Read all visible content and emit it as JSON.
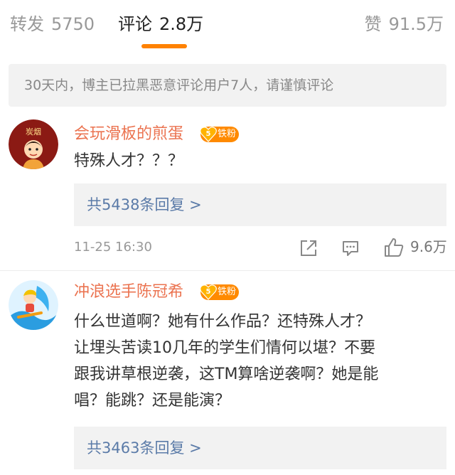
{
  "tabs": {
    "repost": {
      "label": "转发",
      "count": "5750"
    },
    "comments": {
      "label": "评论",
      "count": "2.8万"
    },
    "likes": {
      "label": "赞",
      "count": "91.5万"
    }
  },
  "notice": "30天内，博主已拉黑恶意评论用户7人，请谨慎评论",
  "comments": [
    {
      "username": "会玩滑板的煎蛋",
      "badge": "铁粉",
      "badge_level": "5",
      "avatar_text": "炭烟",
      "text": "特殊人才？？？",
      "replies": "共5438条回复 >",
      "time": "11-25 16:30",
      "likes": "9.6万"
    },
    {
      "username": "冲浪选手陈冠希",
      "badge": "铁粉",
      "badge_level": "5",
      "text_lines": [
        "什么世道啊？她有什么作品？还特殊人才？",
        "让埋头苦读10几年的学生们情何以堪？不要",
        "跟我讲草根逆袭，这TM算啥逆袭啊？她是能",
        "唱？能跳？还是能演？"
      ],
      "replies": "共3463条回复 >"
    }
  ],
  "colors": {
    "accent": "#ff8200",
    "username": "#eb7350",
    "link": "#5b7ba8",
    "badge": "#ff8a00"
  },
  "icons": [
    "share-icon",
    "comment-icon",
    "thumbs-up-icon",
    "heart-badge-icon"
  ]
}
